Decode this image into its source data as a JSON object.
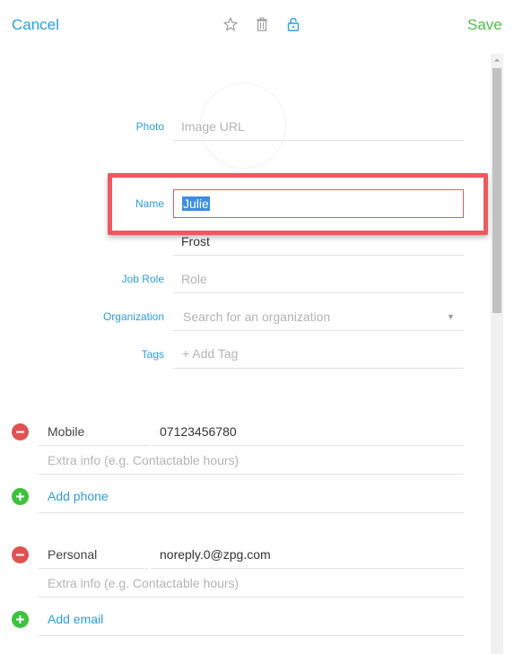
{
  "toolbar": {
    "cancel_label": "Cancel",
    "save_label": "Save",
    "icons": [
      "star-icon",
      "trash-icon",
      "lock-icon"
    ]
  },
  "form": {
    "photo": {
      "label": "Photo",
      "placeholder": "Image URL"
    },
    "name": {
      "label": "Name",
      "first_name": "Julie",
      "last_name": "Frost"
    },
    "job_role": {
      "label": "Job Role",
      "placeholder": "Role"
    },
    "organization": {
      "label": "Organization",
      "placeholder": "Search for an organization"
    },
    "tags": {
      "label": "Tags",
      "placeholder": "+ Add Tag"
    }
  },
  "phones": {
    "items": [
      {
        "type": "Mobile",
        "value": "07123456780",
        "extra_placeholder": "Extra info (e.g. Contactable hours)"
      }
    ],
    "add_label": "Add phone"
  },
  "emails": {
    "items": [
      {
        "type": "Personal",
        "value": "noreply.0@zpg.com",
        "extra_placeholder": "Extra info (e.g. Contactable hours)"
      }
    ],
    "add_label": "Add email"
  },
  "colors": {
    "accent": "#2d9ee0",
    "save": "#4cc04a",
    "remove": "#e05252",
    "add": "#3cc23c",
    "highlight": "#f0585f"
  }
}
